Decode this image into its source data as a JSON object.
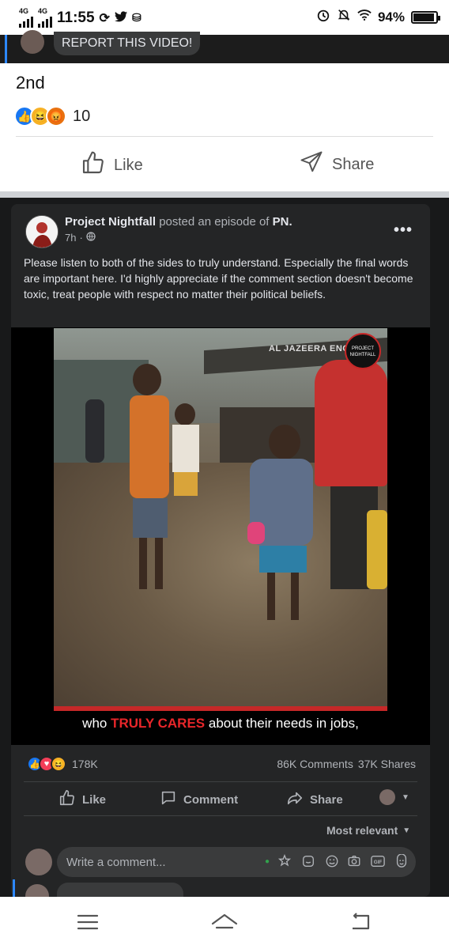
{
  "status_bar": {
    "network_1": "4G",
    "network_2": "4G",
    "time": "11:55",
    "battery": "94%",
    "battery_level": 0.94
  },
  "previous_video": {
    "report_label": "REPORT THIS VIDEO!"
  },
  "comment": {
    "text": "2nd",
    "reaction_count": "10"
  },
  "light_actions": {
    "like_label": "Like",
    "share_label": "Share"
  },
  "post": {
    "author": "Project Nightfall",
    "posted_text": "posted an episode of",
    "show": "PN.",
    "time": "7h",
    "body": "Please listen to both of the sides to truly understand. Especially the final words are important here. I'd highly appreciate if the comment section doesn't become toxic, treat people with respect no matter their political beliefs."
  },
  "video": {
    "watermark": "AL JAZEERA ENGLISH",
    "logo_text": "PROJECT NIGHTFALL",
    "caption_before": "who",
    "caption_highlight": "TRULY CARES",
    "caption_after": "about their needs in jobs,"
  },
  "stats": {
    "reactions": "178K",
    "comments": "86K Comments",
    "shares": "37K Shares"
  },
  "dark_actions": {
    "like_label": "Like",
    "comment_label": "Comment",
    "share_label": "Share"
  },
  "sort": {
    "label": "Most relevant"
  },
  "comment_box": {
    "placeholder": "Write a comment..."
  },
  "colors": {
    "facebook_blue": "#2d88ff",
    "dark_bg": "#18191a",
    "card_bg": "#242526",
    "caption_red": "#e8262a"
  }
}
